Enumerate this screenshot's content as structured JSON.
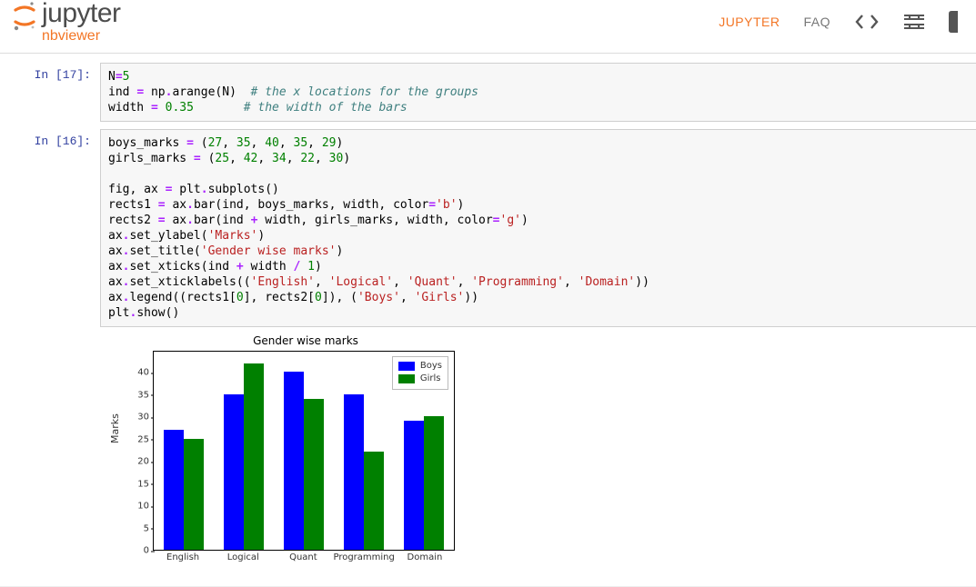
{
  "header": {
    "logo_main": "jupyter",
    "logo_sub": "nbviewer",
    "nav_jupyter": "JUPYTER",
    "nav_faq": "FAQ"
  },
  "cells": {
    "c17_prompt": "In [17]:",
    "c16_prompt": "In [16]:"
  },
  "code17": {
    "l1a": "N",
    "l1b": "=",
    "l1c": "5",
    "l2a": "ind ",
    "l2b": "=",
    "l2c": " np",
    "l2d": ".",
    "l2e": "arange(N)  ",
    "l2f": "# the x locations for the groups",
    "l3a": "width ",
    "l3b": "=",
    "l3c": " ",
    "l3d": "0.35",
    "l3e": "       ",
    "l3f": "# the width of the bars"
  },
  "code16": {
    "l1a": "boys_marks ",
    "l1b": "=",
    "l1c": " (",
    "l1_n1": "27",
    "l1_comma": ", ",
    "l1_n2": "35",
    "l1_n3": "40",
    "l1_n4": "35",
    "l1_n5": "29",
    "l1_close": ")",
    "l2a": "girls_marks ",
    "l2b": "=",
    "l2c": " (",
    "l2_n1": "25",
    "l2_n2": "42",
    "l2_n3": "34",
    "l2_n4": "22",
    "l2_n5": "30",
    "l2_close": ")",
    "blank": "",
    "l4": "fig, ax ",
    "l4b": "=",
    "l4c": " plt",
    "l4d": ".",
    "l4e": "subplots()",
    "l5a": "rects1 ",
    "l5b": "=",
    "l5c": " ax",
    "l5d": ".",
    "l5e": "bar(ind, boys_marks, width, color",
    "l5f": "=",
    "l5g": "'b'",
    "l5h": ")",
    "l6a": "rects2 ",
    "l6b": "=",
    "l6c": " ax",
    "l6d": ".",
    "l6e": "bar(ind ",
    "l6f": "+",
    "l6g": " width, girls_marks, width, color",
    "l6h": "=",
    "l6i": "'g'",
    "l6j": ")",
    "l7a": "ax",
    "l7b": ".",
    "l7c": "set_ylabel(",
    "l7d": "'Marks'",
    "l7e": ")",
    "l8a": "ax",
    "l8b": ".",
    "l8c": "set_title(",
    "l8d": "'Gender wise marks'",
    "l8e": ")",
    "l9a": "ax",
    "l9b": ".",
    "l9c": "set_xticks(ind ",
    "l9d": "+",
    "l9e": " width ",
    "l9f": "/",
    "l9g": " ",
    "l9h": "1",
    "l9i": ")",
    "l10a": "ax",
    "l10b": ".",
    "l10c": "set_xticklabels((",
    "l10d": "'English'",
    "l10e": ", ",
    "l10f": "'Logical'",
    "l10g": ", ",
    "l10h": "'Quant'",
    "l10i": ", ",
    "l10j": "'Programming'",
    "l10k": ", ",
    "l10l": "'Domain'",
    "l10m": "))",
    "l11a": "ax",
    "l11b": ".",
    "l11c": "legend((rects1[",
    "l11d": "0",
    "l11e": "], rects2[",
    "l11f": "0",
    "l11g": "]), (",
    "l11h": "'Boys'",
    "l11i": ", ",
    "l11j": "'Girls'",
    "l11k": "))",
    "l12a": "plt",
    "l12b": ".",
    "l12c": "show()"
  },
  "chart_data": {
    "type": "bar",
    "title": "Gender wise marks",
    "ylabel": "Marks",
    "xlabel": "",
    "categories": [
      "English",
      "Logical",
      "Quant",
      "Programming",
      "Domain"
    ],
    "series": [
      {
        "name": "Boys",
        "color": "#0000ff",
        "values": [
          27,
          35,
          40,
          35,
          29
        ]
      },
      {
        "name": "Girls",
        "color": "#008000",
        "values": [
          25,
          42,
          34,
          22,
          30
        ]
      }
    ],
    "ylim": [
      0,
      45
    ],
    "yticks": [
      0,
      5,
      10,
      15,
      20,
      25,
      30,
      35,
      40
    ],
    "legend_pos": "upper right"
  }
}
